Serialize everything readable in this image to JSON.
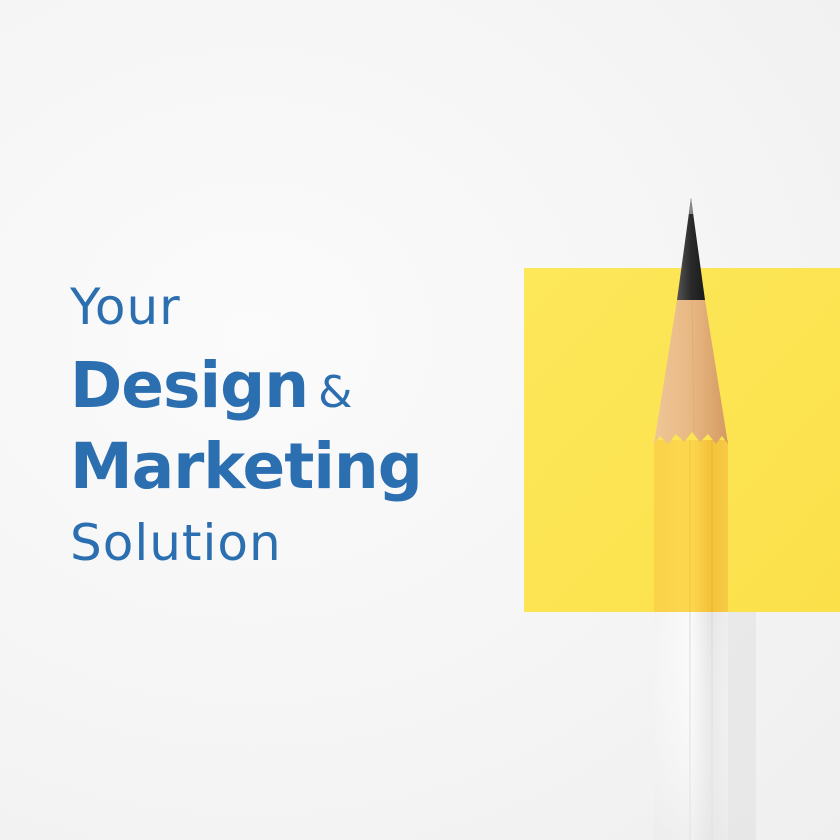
{
  "headline": {
    "line1": "Your",
    "line2": "Design",
    "ampersand": "&",
    "line3": "Marketing",
    "line4": "Solution"
  },
  "colors": {
    "text": "#2c6fb1",
    "background": "#f6f6f6",
    "sticky_note": "#fde95c",
    "pencil_body": "#fcd64a",
    "pencil_wood": "#e6b98a",
    "pencil_lead": "#3a3a3a"
  },
  "illustration": {
    "icon": "pencil-icon",
    "note": "yellow-square"
  }
}
